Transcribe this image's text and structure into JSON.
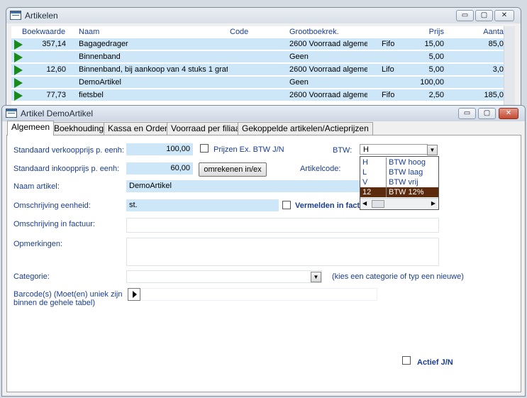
{
  "back_window": {
    "title": "Artikelen",
    "columns": [
      "Boekwaarde",
      "Naam",
      "Code",
      "Grootboekrek.",
      "Prijs",
      "Aanta"
    ],
    "rows": [
      {
        "boekwaarde": "357,14",
        "naam": "Bagagedrager",
        "code": "",
        "grootboek": "2600 Voorraad algeme",
        "methode": "Fifo",
        "prijs": "15,00",
        "aantal": "85,0"
      },
      {
        "boekwaarde": "",
        "naam": "Binnenband",
        "code": "",
        "grootboek": "Geen",
        "methode": "",
        "prijs": "5,00",
        "aantal": ""
      },
      {
        "boekwaarde": "12,60",
        "naam": "Binnenband, bij aankoop van 4 stuks 1 grati",
        "code": "",
        "grootboek": "2600 Voorraad algeme",
        "methode": "Lifo",
        "prijs": "5,00",
        "aantal": "3,0"
      },
      {
        "boekwaarde": "",
        "naam": "DemoArtikel",
        "code": "",
        "grootboek": "Geen",
        "methode": "",
        "prijs": "100,00",
        "aantal": ""
      },
      {
        "boekwaarde": "77,73",
        "naam": "fietsbel",
        "code": "",
        "grootboek": "2600 Voorraad algeme",
        "methode": "Fifo",
        "prijs": "2,50",
        "aantal": "185,0"
      }
    ]
  },
  "window_buttons": {
    "minimize": "▭",
    "maximize": "▢",
    "close": "✕"
  },
  "front_window": {
    "title": "Artikel DemoArtikel",
    "tabs": [
      "Algemeen",
      "Boekhouding",
      "Kassa en Orders",
      "Voorraad per filiaal",
      "Gekoppelde artikelen/Actieprijzen"
    ],
    "active_tab": "Algemeen",
    "form": {
      "verkoopprijs_label": "Standaard verkoopprijs p. eenh:",
      "verkoopprijs_value": "100,00",
      "prijzen_ex_btw_label": "Prijzen Ex. BTW J/N",
      "prijzen_ex_btw_checked": false,
      "btw_label": "BTW:",
      "btw_value": "H",
      "inkoopprijs_label": "Standaard inkoopprijs p. eenh:",
      "inkoopprijs_value": "60,00",
      "omrekenen_button": "omrekenen in/ex",
      "artikelcode_label": "Artikelcode:",
      "naam_label": "Naam artikel:",
      "naam_value": "DemoArtikel",
      "omschrijving_eenheid_label": "Omschrijving eenheid:",
      "omschrijving_eenheid_value": "st.",
      "vermelden_label": "Vermelden in factuu",
      "vermelden_checked": false,
      "omschrijving_factuur_label": "Omschrijving in factuur:",
      "omschrijving_factuur_value": "",
      "opmerkingen_label": "Opmerkingen:",
      "opmerkingen_value": "",
      "categorie_label": "Categorie:",
      "categorie_value": "",
      "categorie_hint": "(kies een categorie of typ een nieuwe)",
      "barcode_label": "Barcode(s) (Moet(en) uniek zijn binnen de gehele tabel)",
      "barcode_value": "",
      "actief_label": "Actief J/N",
      "actief_checked": true
    },
    "btw_dropdown": [
      {
        "code": "H",
        "desc": "BTW hoog"
      },
      {
        "code": "L",
        "desc": "BTW laag"
      },
      {
        "code": "V",
        "desc": "BTW vrij"
      },
      {
        "code": "12",
        "desc": "BTW 12%"
      }
    ],
    "btw_dropdown_selected": "12"
  },
  "icons": [
    "window-icon",
    "play-icon",
    "checkbox-icon",
    "dropdown-arrow-icon",
    "record-nav-icon",
    "scroll-left-icon",
    "scroll-right-icon"
  ],
  "colors": {
    "field_bg": "#cde6f8",
    "label_blue": "#1a3d8f",
    "selection": "#5c2a0c",
    "play_green": "#1a8a1a"
  }
}
